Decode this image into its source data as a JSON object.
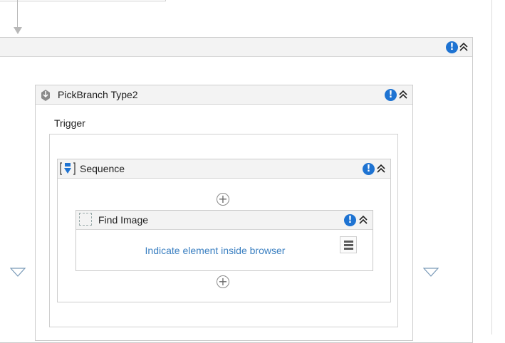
{
  "pick_branch": {
    "title": "PickBranch Type2"
  },
  "trigger": {
    "label": "Trigger"
  },
  "sequence": {
    "title": "Sequence"
  },
  "find_image": {
    "title": "Find Image",
    "link_text": "Indicate element inside browser"
  },
  "icons": {
    "warning": "exclamation-circle-icon",
    "collapse": "double-chevron-up-icon",
    "add": "plus-circle-icon",
    "menu": "hamburger-menu-icon",
    "drop_target": "triangle-down-outline-icon"
  },
  "colors": {
    "warning": "#1e73d2",
    "link": "#3a7fc1",
    "header_bg": "#f3f3f3"
  }
}
